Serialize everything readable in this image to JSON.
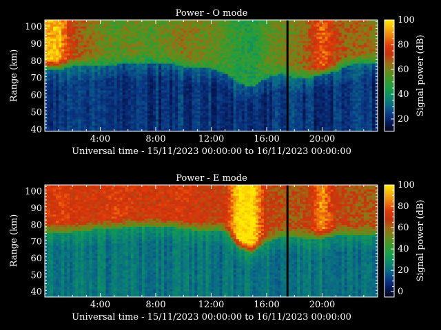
{
  "colorbar_ramp": [
    "#04061a",
    "#061a5a",
    "#0a3a86",
    "#0a6a86",
    "#0c8a6a",
    "#18a048",
    "#3a9a2a",
    "#6a8a1a",
    "#a06a14",
    "#c8320e",
    "#e03a0a",
    "#f07a0c",
    "#f8b40a",
    "#ffe800"
  ],
  "chart_data": [
    {
      "type": "heatmap",
      "title": "Power - O mode",
      "xlabel": "Universal time - 15/11/2023 00:00:00 to 16/11/2023 00:00:00",
      "ylabel": "Range (km)",
      "colorbar_label": "Signal power (dB)",
      "x_ticks": [
        "4:00",
        "8:00",
        "12:00",
        "16:00",
        "20:00"
      ],
      "x_tick_hours": [
        4,
        8,
        12,
        16,
        20
      ],
      "xlim_hours": [
        0,
        24
      ],
      "y_ticks": [
        40,
        50,
        60,
        70,
        80,
        90,
        100
      ],
      "ylim": [
        39,
        104
      ],
      "cbar_ticks": [
        20,
        40,
        60,
        80,
        100
      ],
      "cbar_lim": [
        10,
        100
      ],
      "data_gap_hour": 17.5,
      "layer_floor_km": [
        [
          0,
          75
        ],
        [
          1,
          75
        ],
        [
          2,
          77
        ],
        [
          3,
          77
        ],
        [
          4,
          78
        ],
        [
          5,
          78
        ],
        [
          6,
          79
        ],
        [
          7,
          79
        ],
        [
          8,
          79
        ],
        [
          9,
          79
        ],
        [
          10,
          77
        ],
        [
          11,
          76
        ],
        [
          12,
          76
        ],
        [
          13,
          73
        ],
        [
          14,
          67
        ],
        [
          15,
          65
        ],
        [
          16,
          70
        ],
        [
          17,
          73
        ],
        [
          18,
          70
        ],
        [
          19,
          70
        ],
        [
          20,
          72
        ],
        [
          21,
          74
        ],
        [
          22,
          78
        ],
        [
          23,
          79
        ],
        [
          24,
          79
        ]
      ],
      "peak_power_db": [
        [
          0,
          92
        ],
        [
          1,
          95
        ],
        [
          2,
          70
        ],
        [
          3,
          65
        ],
        [
          4,
          60
        ],
        [
          5,
          55
        ],
        [
          6,
          58
        ],
        [
          7,
          55
        ],
        [
          8,
          55
        ],
        [
          9,
          58
        ],
        [
          10,
          62
        ],
        [
          11,
          60
        ],
        [
          12,
          58
        ],
        [
          13,
          52
        ],
        [
          14,
          48
        ],
        [
          15,
          45
        ],
        [
          16,
          55
        ],
        [
          17,
          58
        ],
        [
          18,
          60
        ],
        [
          19,
          66
        ],
        [
          20,
          85
        ],
        [
          21,
          70
        ],
        [
          22,
          65
        ],
        [
          23,
          65
        ],
        [
          24,
          62
        ]
      ]
    },
    {
      "type": "heatmap",
      "title": "Power - E mode",
      "xlabel": "Universal time - 15/11/2023 00:00:00 to 16/11/2023 00:00:00",
      "ylabel": "Range (km)",
      "colorbar_label": "Signal power (dB)",
      "x_ticks": [
        "4:00",
        "8:00",
        "12:00",
        "16:00",
        "20:00"
      ],
      "x_tick_hours": [
        4,
        8,
        12,
        16,
        20
      ],
      "xlim_hours": [
        0,
        24
      ],
      "y_ticks": [
        40,
        50,
        60,
        70,
        80,
        90,
        100
      ],
      "ylim": [
        37,
        104
      ],
      "cbar_ticks": [
        0,
        20,
        40,
        60,
        80,
        100
      ],
      "cbar_lim": [
        -5,
        100
      ],
      "data_gap_hour": 17.5,
      "layer_floor_km": [
        [
          0,
          76
        ],
        [
          1,
          76
        ],
        [
          2,
          76
        ],
        [
          3,
          77
        ],
        [
          4,
          78
        ],
        [
          5,
          78
        ],
        [
          6,
          79
        ],
        [
          7,
          79
        ],
        [
          8,
          79
        ],
        [
          9,
          79
        ],
        [
          10,
          78
        ],
        [
          11,
          77
        ],
        [
          12,
          77
        ],
        [
          13,
          76
        ],
        [
          14,
          66
        ],
        [
          15,
          63
        ],
        [
          16,
          70
        ],
        [
          17,
          73
        ],
        [
          18,
          73
        ],
        [
          19,
          72
        ],
        [
          20,
          72
        ],
        [
          21,
          74
        ],
        [
          22,
          74
        ],
        [
          23,
          74
        ],
        [
          24,
          74
        ]
      ],
      "peak_power_db": [
        [
          0,
          70
        ],
        [
          1,
          75
        ],
        [
          2,
          72
        ],
        [
          3,
          70
        ],
        [
          4,
          70
        ],
        [
          5,
          75
        ],
        [
          6,
          72
        ],
        [
          7,
          70
        ],
        [
          8,
          70
        ],
        [
          9,
          72
        ],
        [
          10,
          72
        ],
        [
          11,
          70
        ],
        [
          12,
          68
        ],
        [
          13,
          68
        ],
        [
          14,
          100
        ],
        [
          15,
          100
        ],
        [
          16,
          66
        ],
        [
          17,
          64
        ],
        [
          18,
          62
        ],
        [
          19,
          64
        ],
        [
          20,
          90
        ],
        [
          21,
          66
        ],
        [
          22,
          64
        ],
        [
          23,
          62
        ],
        [
          24,
          62
        ]
      ]
    }
  ]
}
